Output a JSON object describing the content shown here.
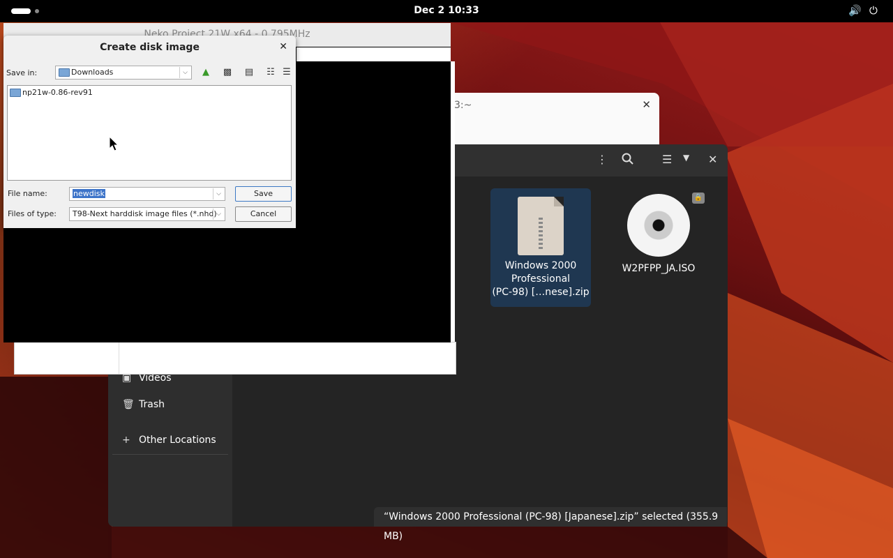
{
  "topbar": {
    "clock": "Dec 2  10:33",
    "volume_icon": "volume-icon",
    "power_icon": "power-icon"
  },
  "neko": {
    "title": "Neko Project 21W x64 - 0.795MHz"
  },
  "terminal": {
    "title_fragment": "3:~"
  },
  "dialog": {
    "title": "Create disk image",
    "save_in_label": "Save in:",
    "save_in_value": "Downloads",
    "list_items": [
      "np21w-0.86-rev91"
    ],
    "file_name_label": "File name:",
    "file_name_value": "newdisk",
    "files_of_type_label": "Files of type:",
    "files_of_type_value": "T98-Next harddisk image files (*.nhd)",
    "save_label": "Save",
    "cancel_label": "Cancel"
  },
  "files": {
    "sidebar": {
      "videos": "Videos",
      "trash": "Trash",
      "other_locations": "Other Locations"
    },
    "items": [
      {
        "name": "Windows 2000 Professional (PC-98) [...nese].zip",
        "line1": "Windows 2000",
        "line2": "Professional",
        "line3": "(PC-98) […nese].zip",
        "type": "zip"
      },
      {
        "name": "W2PFPP_JA.ISO",
        "type": "iso"
      }
    ],
    "status": "“Windows 2000 Professional (PC-98) [Japanese].zip” selected  (355.9 MB)"
  }
}
